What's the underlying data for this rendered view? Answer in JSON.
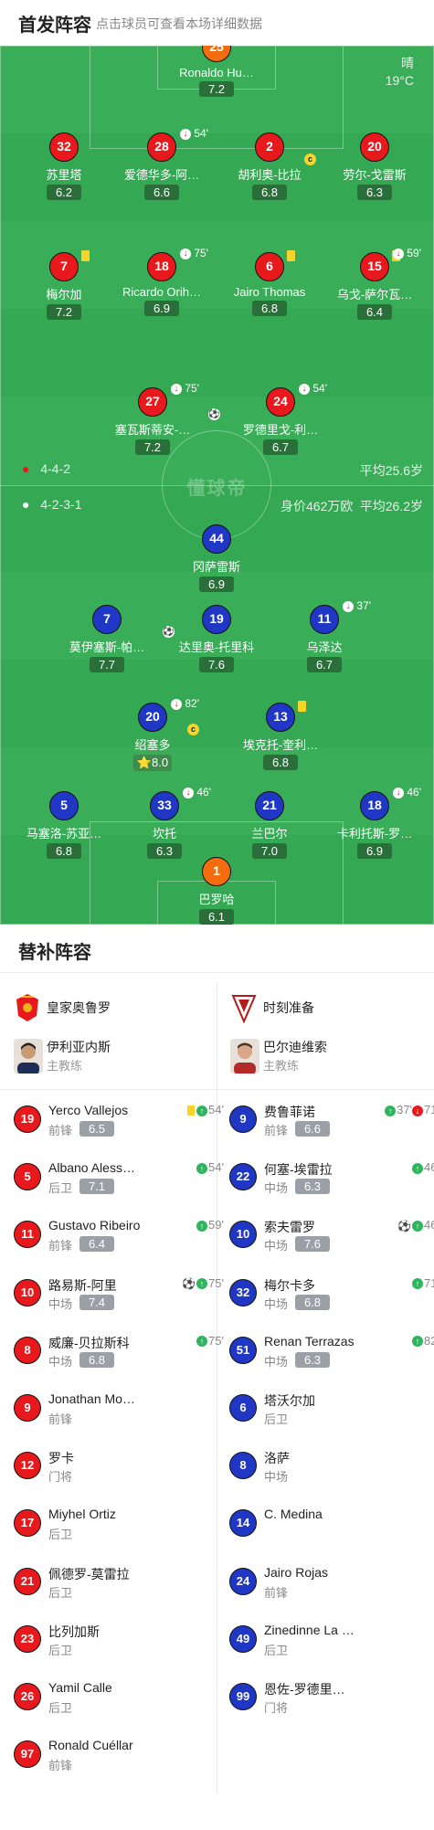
{
  "header": {
    "title": "首发阵容",
    "subtitle": "点击球员可查看本场详细数据"
  },
  "pitch": {
    "watermark": "懂球帝",
    "weather": {
      "condition": "晴",
      "temp": "19°C"
    },
    "home_info": {
      "formation": "4-4-2",
      "avg_age": "平均25.6岁"
    },
    "away_info": {
      "formation": "4-2-3-1",
      "value": "身价462万欧",
      "avg_age": "平均26.2岁"
    }
  },
  "home_lineup": [
    {
      "num": "25",
      "name": "Ronaldo Hu…",
      "rating": "7.2",
      "gk": true
    },
    {
      "num": "32",
      "name": "苏里塔",
      "rating": "6.2"
    },
    {
      "num": "28",
      "name": "爱德华多-阿…",
      "rating": "6.6",
      "event": "54'"
    },
    {
      "num": "2",
      "name": "胡利奥-比拉",
      "rating": "6.8",
      "captain": "c"
    },
    {
      "num": "20",
      "name": "劳尔-戈雷斯",
      "rating": "6.3"
    },
    {
      "num": "7",
      "name": "梅尔加",
      "rating": "7.2",
      "yellow": true
    },
    {
      "num": "18",
      "name": "Ricardo Orih…",
      "rating": "6.9",
      "event": "75'"
    },
    {
      "num": "6",
      "name": "Jairo Thomas",
      "rating": "6.8",
      "yellow": true
    },
    {
      "num": "15",
      "name": "乌戈-萨尔瓦…",
      "rating": "6.4",
      "event": "59'",
      "yellow": true
    },
    {
      "num": "27",
      "name": "塞瓦斯蒂安-…",
      "rating": "7.2",
      "event": "75'",
      "ball": true
    },
    {
      "num": "24",
      "name": "罗德里戈-利…",
      "rating": "6.7",
      "event": "54'"
    }
  ],
  "away_lineup": [
    {
      "num": "44",
      "name": "冈萨雷斯",
      "rating": "6.9"
    },
    {
      "num": "7",
      "name": "莫伊塞斯-帕…",
      "rating": "7.7",
      "ball": true
    },
    {
      "num": "19",
      "name": "达里奥-托里科",
      "rating": "7.6"
    },
    {
      "num": "11",
      "name": "乌泽达",
      "rating": "6.7",
      "event": "37'"
    },
    {
      "num": "20",
      "name": "绍塞多",
      "rating": "8.0",
      "event": "82'",
      "captain": "c",
      "star": "⭐"
    },
    {
      "num": "13",
      "name": "埃克托-奎利…",
      "rating": "6.8",
      "yellow": true
    },
    {
      "num": "5",
      "name": "马塞洛-苏亚…",
      "rating": "6.8"
    },
    {
      "num": "33",
      "name": "坎托",
      "rating": "6.3",
      "event": "46'"
    },
    {
      "num": "21",
      "name": "兰巴尔",
      "rating": "7.0"
    },
    {
      "num": "18",
      "name": "卡利托斯-罗…",
      "rating": "6.9",
      "event": "46'"
    },
    {
      "num": "1",
      "name": "巴罗哈",
      "rating": "6.1",
      "gk": true
    }
  ],
  "subs": {
    "title": "替补阵容",
    "home_team": "皇家奥鲁罗",
    "away_team": "时刻准备",
    "home_coach": {
      "name": "伊利亚内斯",
      "role": "主教练"
    },
    "away_coach": {
      "name": "巴尔迪维索",
      "role": "主教练"
    },
    "home": [
      {
        "num": "19",
        "name": "Yerco Vallejos",
        "pos": "前锋",
        "rating": "6.5",
        "events": "54'",
        "icons": "yc,in"
      },
      {
        "num": "5",
        "name": "Albano Aless…",
        "pos": "后卫",
        "rating": "7.1",
        "events": "54'",
        "icons": "in"
      },
      {
        "num": "11",
        "name": "Gustavo Ribeiro",
        "pos": "前锋",
        "rating": "6.4",
        "events": "59'",
        "icons": "in"
      },
      {
        "num": "10",
        "name": "路易斯-阿里",
        "pos": "中场",
        "rating": "7.4",
        "events": "75'",
        "icons": "ball,in"
      },
      {
        "num": "8",
        "name": "威廉-贝拉斯科",
        "pos": "中场",
        "rating": "6.8",
        "events": "75'",
        "icons": "in"
      },
      {
        "num": "9",
        "name": "Jonathan Mo…",
        "pos": "前锋"
      },
      {
        "num": "12",
        "name": "罗卡",
        "pos": "门将"
      },
      {
        "num": "17",
        "name": "Miyhel Ortiz",
        "pos": "后卫"
      },
      {
        "num": "21",
        "name": "佩德罗-莫雷拉",
        "pos": "后卫"
      },
      {
        "num": "23",
        "name": "比列加斯",
        "pos": "后卫"
      },
      {
        "num": "26",
        "name": "Yamil Calle",
        "pos": "后卫"
      },
      {
        "num": "97",
        "name": "Ronald Cuéllar",
        "pos": "前锋"
      }
    ],
    "away": [
      {
        "num": "9",
        "name": "费鲁菲诺",
        "pos": "前锋",
        "rating": "6.6",
        "events_in": "37'",
        "events_out": "71'",
        "icons": "in,out"
      },
      {
        "num": "22",
        "name": "何塞-埃雷拉",
        "pos": "中场",
        "rating": "6.3",
        "events": "46'",
        "icons": "in"
      },
      {
        "num": "10",
        "name": "索夫雷罗",
        "pos": "中场",
        "rating": "7.6",
        "events": "46'",
        "icons": "ball,in"
      },
      {
        "num": "32",
        "name": "梅尔卡多",
        "pos": "中场",
        "rating": "6.8",
        "events": "71'",
        "icons": "in"
      },
      {
        "num": "51",
        "name": "Renan Terrazas",
        "pos": "中场",
        "rating": "6.3",
        "events": "82'",
        "icons": "in"
      },
      {
        "num": "6",
        "name": "塔沃尔加",
        "pos": "后卫"
      },
      {
        "num": "8",
        "name": "洛萨",
        "pos": "中场"
      },
      {
        "num": "14",
        "name": "C. Medina",
        "pos": ""
      },
      {
        "num": "24",
        "name": "Jairo Rojas",
        "pos": "前锋"
      },
      {
        "num": "49",
        "name": "Zinedinne La …",
        "pos": "后卫"
      },
      {
        "num": "99",
        "name": "恩佐-罗德里…",
        "pos": "门将"
      }
    ]
  }
}
